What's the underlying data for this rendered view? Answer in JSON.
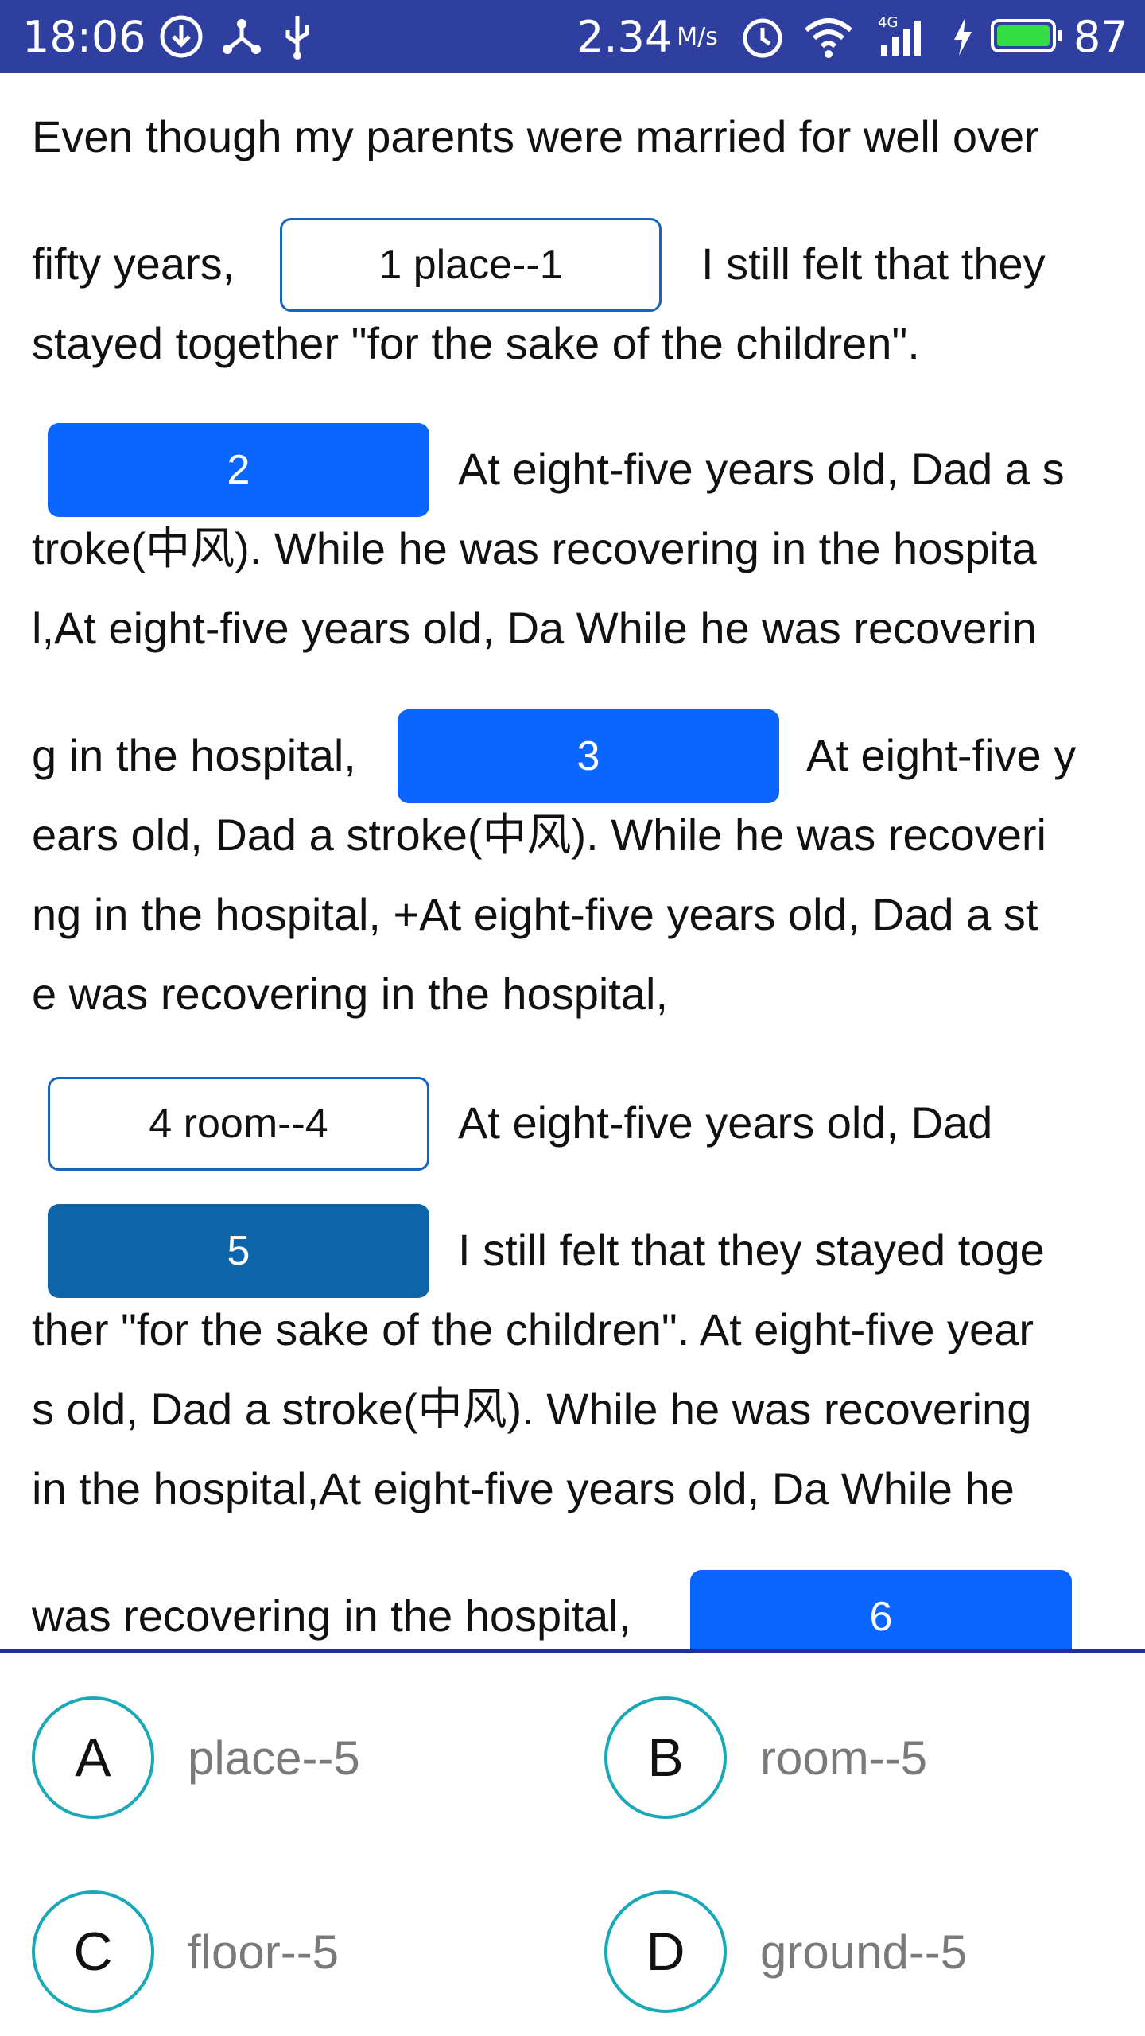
{
  "status_bar": {
    "time": "18:06",
    "network_speed": "2.34",
    "network_unit": "M/s",
    "network_type": "4G",
    "battery": "87",
    "icons": [
      "download-icon",
      "share-icon",
      "usb-icon",
      "alarm-icon",
      "wifi-icon",
      "signal-icon",
      "charging-icon",
      "battery-icon"
    ]
  },
  "passage": {
    "lines": [
      "Even though my parents were married for well over",
      "fifty years,",
      "I still felt that they",
      "stayed together \"for the sake of the children\".",
      "At eight-five years old, Dad a s",
      "troke(中风). While he was recovering in the hospita",
      "l,At eight-five years old, Da  While he was recoverin",
      "g in the hospital,",
      "At eight-five y",
      "ears old, Dad a stroke(中风). While he was recoveri",
      "ng in the hospital, +At eight-five years old, Dad a st",
      " e was recovering in the hospital,",
      "At eight-five years old, Dad",
      "I still felt that they stayed toge",
      "ther \"for the sake of the children\". At eight-five year",
      "s old, Dad a stroke(中风). While he was recovering",
      "in the hospital,At eight-five years old, Da  While he",
      "was recovering in the hospital,"
    ],
    "blanks": [
      {
        "label": "1 place--1"
      },
      {
        "label": "2"
      },
      {
        "label": "3"
      },
      {
        "label": "4 room--4"
      },
      {
        "label": "5"
      },
      {
        "label": "6"
      }
    ]
  },
  "options": [
    {
      "letter": "A",
      "text": "place--5"
    },
    {
      "letter": "B",
      "text": "room--5"
    },
    {
      "letter": "C",
      "text": "floor--5"
    },
    {
      "letter": "D",
      "text": "ground--5"
    }
  ],
  "colors": {
    "status_bar": "#2f3fa0",
    "blank_selected": "#0a66ff",
    "blank_current": "#0d64a8",
    "blank_border": "#1565c0",
    "option_ring": "#19a8b8",
    "divider": "#2030a0"
  }
}
